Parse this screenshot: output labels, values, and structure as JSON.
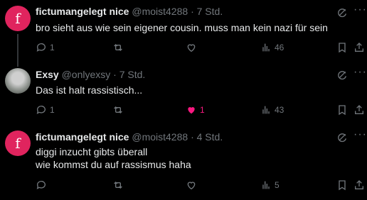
{
  "tweets": [
    {
      "avatar_letter": "f",
      "name": "fictumangelegt nice",
      "handle": "@moist4288",
      "time": "7 Std.",
      "text": "bro sieht aus wie sein eigener cousin. muss man kein nazi für sein",
      "replies": "1",
      "reposts": "",
      "likes": "",
      "views": "46"
    },
    {
      "name": "Exsy",
      "handle": "@onlyexsy",
      "time": "7 Std.",
      "text": "Das ist halt rassistisch...",
      "replies": "1",
      "reposts": "",
      "likes": "1",
      "views": "43",
      "liked_color": "#f91880"
    },
    {
      "avatar_letter": "f",
      "name": "fictumangelegt nice",
      "handle": "@moist4288",
      "time": "4 Std.",
      "text": "diggi inzucht gibts überall\nwie kommst du auf rassismus haha",
      "replies": "",
      "reposts": "",
      "likes": "",
      "views": "5"
    }
  ],
  "separator": "·",
  "colors": {
    "accent_avatar": "#e0245e",
    "like": "#f91880",
    "muted": "#71767b"
  }
}
